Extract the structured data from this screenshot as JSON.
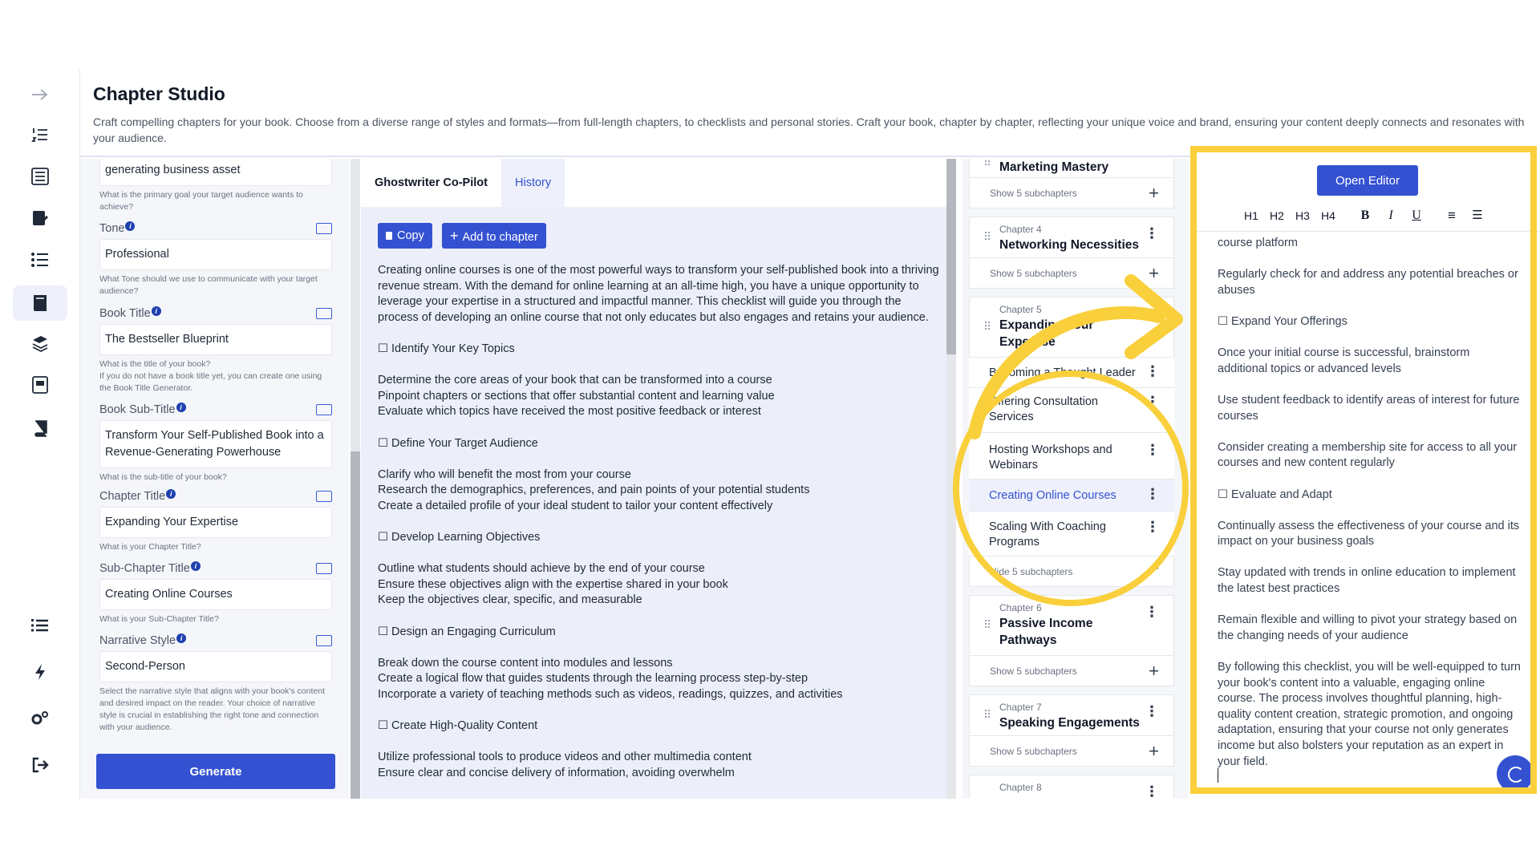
{
  "page": {
    "title": "Chapter Studio",
    "description": "Craft compelling chapters for your book. Choose from a diverse range of styles and formats—from full-length chapters, to checklists and personal stories. Craft your book, chapter by chapter, reflecting your unique voice and brand, ensuring your content deeply connects and resonates with your audience."
  },
  "rail": {
    "icons": [
      "arrow-right-icon",
      "numbered-list-icon",
      "book-list-icon",
      "edit-doc-icon",
      "checklist-icon",
      "book-icon",
      "stack-edit-icon",
      "template-icon",
      "notebook-icon",
      "list-icon",
      "bolt-icon",
      "settings-icon",
      "logout-icon"
    ]
  },
  "form": {
    "goal_value": "generating business asset",
    "goal_help": "What is the primary goal your target audience wants to achieve?",
    "tone_label": "Tone",
    "tone_value": "Professional",
    "tone_help": "What Tone should we use to communicate with your target audience?",
    "book_title_label": "Book Title",
    "book_title_value": "The Bestseller Blueprint",
    "book_title_help": "What is the title of your book?\nIf you do not have a book title yet, you can create one using the Book Title Generator.",
    "book_subtitle_label": "Book Sub-Title",
    "book_subtitle_value": "Transform Your Self-Published Book into a Revenue-Generating Powerhouse",
    "book_subtitle_help": "What is the sub-title of your book?",
    "chapter_title_label": "Chapter Title",
    "chapter_title_value": "Expanding Your Expertise",
    "chapter_title_help": "What is your Chapter Title?",
    "subchapter_title_label": "Sub-Chapter Title",
    "subchapter_title_value": "Creating Online Courses",
    "subchapter_title_help": "What is your Sub-Chapter Title?",
    "narrative_label": "Narrative Style",
    "narrative_value": "Second-Person",
    "narrative_help": "Select the narrative style that aligns with your book's content and desired impact on the reader. Your choice of narrative style is crucial in establishing the right tone and connection with your audience.",
    "generate_label": "Generate"
  },
  "copilot": {
    "tab_ghost": "Ghostwriter Co-Pilot",
    "tab_history": "History",
    "copy_label": "Copy",
    "add_label": "Add to chapter",
    "paragraphs": [
      "Creating online courses is one of the most powerful ways to transform your self-published book into a thriving revenue stream. With the demand for online learning at an all-time high, you have a unique opportunity to leverage your expertise in a structured and impactful manner. This checklist will guide you through the process of developing an online course that not only educates but also engages and retains your audience.",
      "☐ Identify Your Key Topics",
      "Determine the core areas of your book that can be transformed into a course\nPinpoint chapters or sections that offer substantial content and learning value\nEvaluate which topics have received the most positive feedback or interest",
      "☐ Define Your Target Audience",
      "Clarify who will benefit the most from your course\nResearch the demographics, preferences, and pain points of your potential students\nCreate a detailed profile of your ideal student to tailor your content effectively",
      "☐ Develop Learning Objectives",
      "Outline what students should achieve by the end of your course\nEnsure these objectives align with the expertise shared in your book\nKeep the objectives clear, specific, and measurable",
      "☐ Design an Engaging Curriculum",
      "Break down the course content into modules and lessons\nCreate a logical flow that guides students through the learning process step-by-step\nIncorporate a variety of teaching methods such as videos, readings, quizzes, and activities",
      "☐ Create High-Quality Content",
      "Utilize professional tools to produce videos and other multimedia content\nEnsure clear and concise delivery of information, avoiding overwhelm"
    ]
  },
  "chapters": {
    "ch3_title": "Marketing Mastery",
    "show_sub": "Show 5 subchapters",
    "hide_sub": "Hide 5 subchapters",
    "ch4_num": "Chapter 4",
    "ch4_title": "Networking Necessities",
    "ch5_num": "Chapter 5",
    "ch5_title": "Expanding Your Expertise",
    "sub1": "Becoming a Thought Leader",
    "sub2": "Offering Consultation Services",
    "sub3": "Hosting Workshops and Webinars",
    "sub4": "Creating Online Courses",
    "sub5": "Scaling With Coaching Programs",
    "ch6_num": "Chapter 6",
    "ch6_title": "Passive Income Pathways",
    "ch7_num": "Chapter 7",
    "ch7_title": "Speaking Engagements",
    "ch8_num": "Chapter 8"
  },
  "editor": {
    "open_label": "Open Editor",
    "toolbar": [
      "H1",
      "H2",
      "H3",
      "H4",
      "B",
      "I",
      "U",
      "≡",
      "☰"
    ],
    "paragraphs": [
      "course platform",
      "Regularly check for and address any potential breaches or abuses",
      "☐ Expand Your Offerings",
      "Once your initial course is successful, brainstorm additional topics or advanced levels",
      "Use student feedback to identify areas of interest for future courses",
      "Consider creating a membership site for access to all your courses and new content regularly",
      "☐ Evaluate and Adapt",
      "Continually assess the effectiveness of your course and its impact on your business goals",
      "Stay updated with trends in online education to implement the latest best practices",
      "Remain flexible and willing to pivot your strategy based on the changing needs of your audience",
      "By following this checklist, you will be well-equipped to turn your book's content into a valuable, engaging online course. The process involves thoughtful planning, high-quality content creation, strategic promotion, and ongoing adaptation, ensuring that your course not only generates income but also bolsters your reputation as an expert in your field."
    ]
  },
  "colors": {
    "accent": "#3451d1",
    "highlight": "#f9cf3b"
  }
}
